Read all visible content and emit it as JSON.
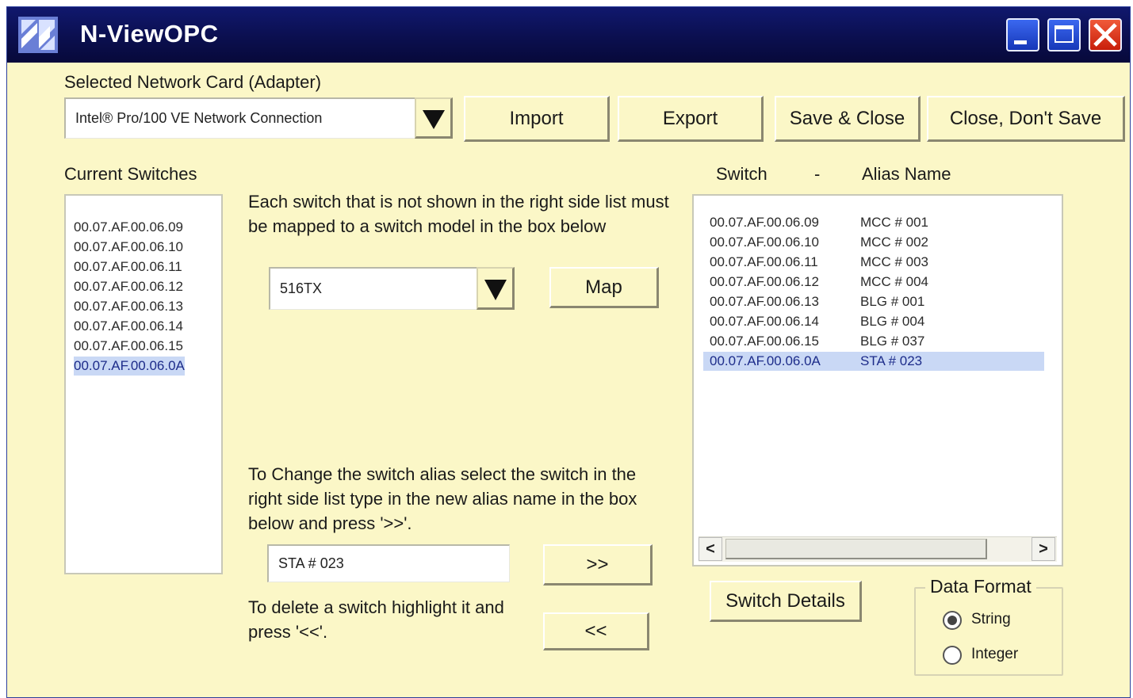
{
  "window": {
    "title": "N-ViewOPC",
    "icons": {
      "logo": "n-view-logo",
      "minimize": "minimize-icon",
      "maximize": "maximize-icon",
      "close": "close-icon"
    }
  },
  "adapter": {
    "label": "Selected Network Card (Adapter)",
    "value": "Intel® Pro/100 VE Network Connection"
  },
  "toolbar": {
    "import_label": "Import",
    "export_label": "Export",
    "save_close_label": "Save & Close",
    "close_nosave_label": "Close, Don't Save"
  },
  "current_switches": {
    "label": "Current Switches",
    "items": [
      "00.07.AF.00.06.09",
      "00.07.AF.00.06.10",
      "00.07.AF.00.06.11",
      "00.07.AF.00.06.12",
      "00.07.AF.00.06.13",
      "00.07.AF.00.06.14",
      "00.07.AF.00.06.15",
      "00.07.AF.00.06.0A"
    ],
    "selected_index": 7
  },
  "mapping": {
    "instructions": "Each switch that is not shown in the right side list must be mapped to a switch model in the box below",
    "model_value": "516TX",
    "map_label": "Map"
  },
  "alias": {
    "instructions": "To Change the switch alias select the switch in the right side list type in the new alias name in the box below and press '>>'.",
    "value": "STA # 023",
    "add_label": ">>",
    "delete_instructions": "To delete a switch highlight it and press '<<'.",
    "remove_label": "<<"
  },
  "alias_list": {
    "header_switch": "Switch",
    "header_sep": "-",
    "header_alias": "Alias Name",
    "items": [
      {
        "switch": "00.07.AF.00.06.09",
        "alias": "MCC # 001"
      },
      {
        "switch": "00.07.AF.00.06.10",
        "alias": "MCC # 002"
      },
      {
        "switch": "00.07.AF.00.06.11",
        "alias": "MCC # 003"
      },
      {
        "switch": "00.07.AF.00.06.12",
        "alias": "MCC # 004"
      },
      {
        "switch": "00.07.AF.00.06.13",
        "alias": "BLG # 001"
      },
      {
        "switch": "00.07.AF.00.06.14",
        "alias": "BLG # 004"
      },
      {
        "switch": "00.07.AF.00.06.15",
        "alias": "BLG # 037"
      },
      {
        "switch": "00.07.AF.00.06.0A",
        "alias": "STA # 023"
      }
    ],
    "selected_index": 7,
    "scroll_left": "<",
    "scroll_right": ">"
  },
  "switch_details_label": "Switch Details",
  "data_format": {
    "title": "Data Format",
    "options": [
      "String",
      "Integer"
    ],
    "selected": "String"
  }
}
